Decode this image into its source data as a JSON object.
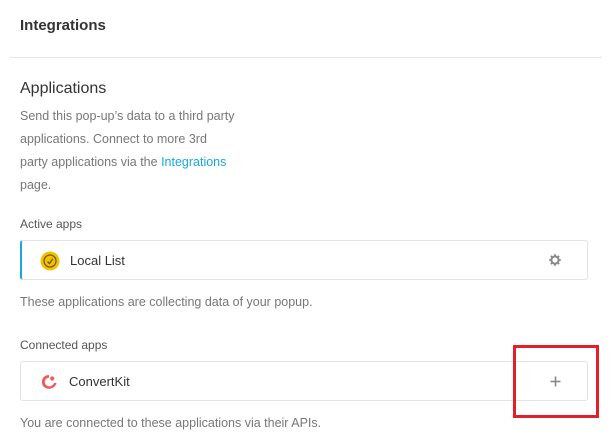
{
  "header": {
    "title": "Integrations"
  },
  "applications": {
    "title": "Applications",
    "description_prefix": "Send this pop-up’s data to a third party applications. Connect to more 3rd party applications via the ",
    "integrations_link": "Integrations",
    "description_suffix": " page."
  },
  "active_apps": {
    "label": "Active apps",
    "items": [
      {
        "name": "Local List",
        "icon": "local-list-icon",
        "action_icon": "gear-icon"
      }
    ],
    "note": "These applications are collecting data of your popup."
  },
  "connected_apps": {
    "label": "Connected apps",
    "items": [
      {
        "name": "ConvertKit",
        "icon": "convertkit-icon",
        "action_icon": "plus-icon"
      }
    ],
    "note": "You are connected to these applications via their APIs."
  },
  "colors": {
    "accent": "#17a8e3",
    "highlight": "#e3202a",
    "local_list": "#f2c200",
    "convertkit": "#f25a5a"
  }
}
